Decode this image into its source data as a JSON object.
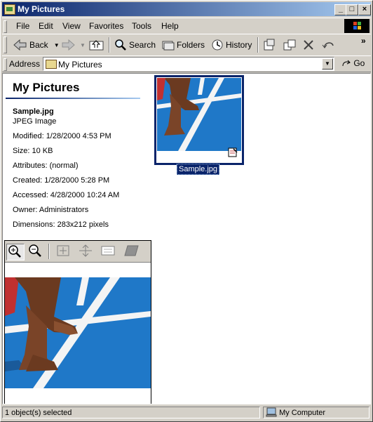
{
  "window": {
    "title": "My Pictures"
  },
  "menu": {
    "items": [
      "File",
      "Edit",
      "View",
      "Favorites",
      "Tools",
      "Help"
    ]
  },
  "toolbar": {
    "back_label": "Back",
    "search_label": "Search",
    "folders_label": "Folders",
    "history_label": "History",
    "overflow_label": "»"
  },
  "address": {
    "label": "Address",
    "value": "My Pictures",
    "go_label": "Go"
  },
  "details": {
    "folder_title": "My Pictures",
    "file_name": "Sample.jpg",
    "file_type": "JPEG Image",
    "modified": "Modified: 1/28/2000 4:53 PM",
    "size": "Size: 10 KB",
    "attributes": "Attributes: (normal)",
    "created": "Created: 1/28/2000 5:28 PM",
    "accessed": "Accessed: 4/28/2000 10:24 AM",
    "owner": "Owner: Administrators",
    "dimensions": "Dimensions: 283x212 pixels"
  },
  "preview_tools": [
    "zoom-in-icon",
    "zoom-out-icon",
    "best-fit-icon",
    "actual-size-icon",
    "slideshow-icon",
    "image-preview-icon"
  ],
  "file_list": [
    {
      "name": "Sample.jpg",
      "selected": true
    }
  ],
  "status": {
    "selection": "1 object(s) selected",
    "zone": "My Computer"
  },
  "colors": {
    "titlebar": "#0a246a",
    "track_blue": "#1f78c8",
    "selection": "#0a246a"
  }
}
